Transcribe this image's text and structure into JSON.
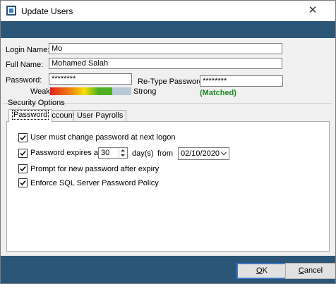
{
  "window": {
    "title": "Update Users",
    "close_symbol": "✕"
  },
  "form": {
    "login_label": "Login Name:",
    "login_value": "Mo",
    "fullname_label": "Full Name:",
    "fullname_value": "Mohamed Salah",
    "password_label": "Password:",
    "password_value": "********",
    "retype_label": "Re-Type Password",
    "retype_value": "********",
    "strength_weak": "Weak",
    "strength_strong": "Strong",
    "match_status": "(Matched)"
  },
  "security": {
    "group_label": "Security Options",
    "tabs": [
      {
        "label": "Password",
        "active": true
      },
      {
        "label": "Account",
        "active": false
      },
      {
        "label": "User Payrolls",
        "active": false
      }
    ],
    "options": {
      "must_change": {
        "label": "User must change password at next logon",
        "checked": true
      },
      "expires": {
        "label": "Password expires after",
        "checked": true,
        "days_value": "30",
        "days_unit": "day(s)",
        "from_label": "from",
        "from_date": "02/10/2020"
      },
      "prompt_new": {
        "label": "Prompt for new password after expiry",
        "checked": true
      },
      "enforce_policy": {
        "label": "Enforce SQL Server Password Policy",
        "checked": true
      }
    }
  },
  "buttons": {
    "ok_prefix": "",
    "ok_mnemonic": "O",
    "ok_rest": "K",
    "cancel_prefix": "",
    "cancel_mnemonic": "C",
    "cancel_rest": "ancel"
  },
  "colors": {
    "header_band": "#2c5677",
    "matched_text": "#1e8a1e",
    "default_button_border": "#3b78c4"
  }
}
